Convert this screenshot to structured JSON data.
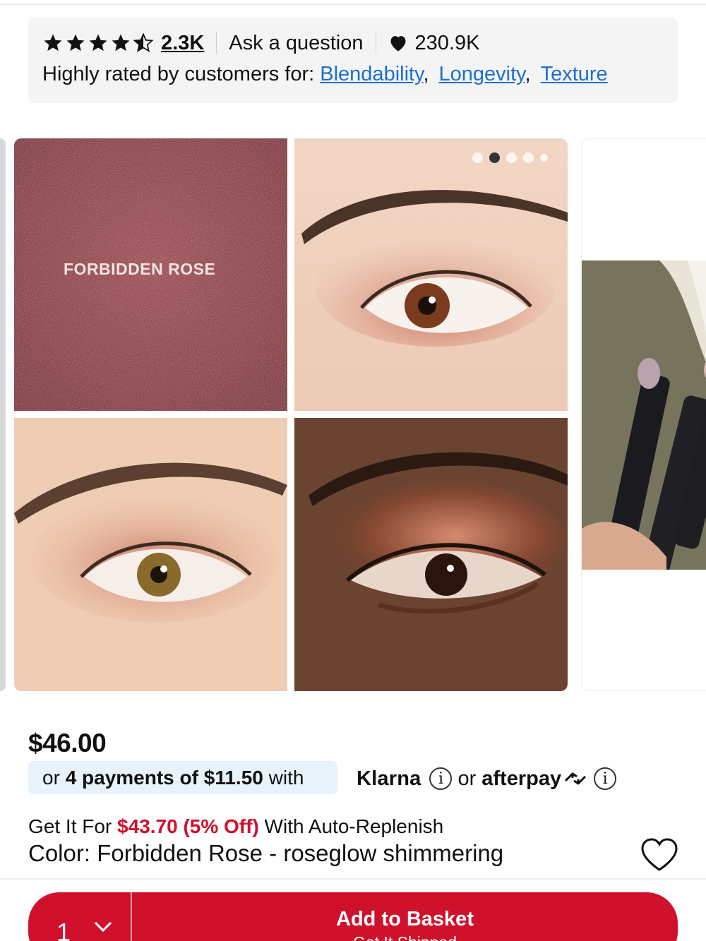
{
  "rating": {
    "stars": 4.5,
    "review_count": "2.3K",
    "ask_label": "Ask a question",
    "loves": "230.9K",
    "highly_rated_prefix": "Highly rated by customers for:",
    "attributes": [
      "Blendability",
      "Longevity",
      "Texture"
    ],
    "separator": ","
  },
  "gallery": {
    "swatch_label": "FORBIDDEN ROSE",
    "total_images": 5,
    "active_index": 1,
    "icons": [
      "star-icon",
      "heart-icon",
      "info-icon",
      "chevron-down-icon",
      "heart-outline-icon"
    ]
  },
  "pricing": {
    "price": "$46.00",
    "installment_prefix": "or ",
    "installment_bold": "4 payments of $11.50",
    "installment_suffix": " with",
    "klarna": "Klarna",
    "or_label": "or",
    "afterpay": "afterpay",
    "replenish_prefix": "Get It For ",
    "replenish_price": "$43.70 (5% Off)",
    "replenish_suffix": " With Auto-Replenish"
  },
  "product": {
    "color_label": "Color: Forbidden Rose - roseglow shimmering"
  },
  "basket": {
    "quantity": "1",
    "button_label": "Add to Basket",
    "sub_label": "Get It Shipped"
  },
  "colors": {
    "accent_red": "#cf112c",
    "link_blue": "#1c6fd1",
    "bnpl_bg": "#e8f2fb",
    "card_bg": "#f4f4f5"
  }
}
